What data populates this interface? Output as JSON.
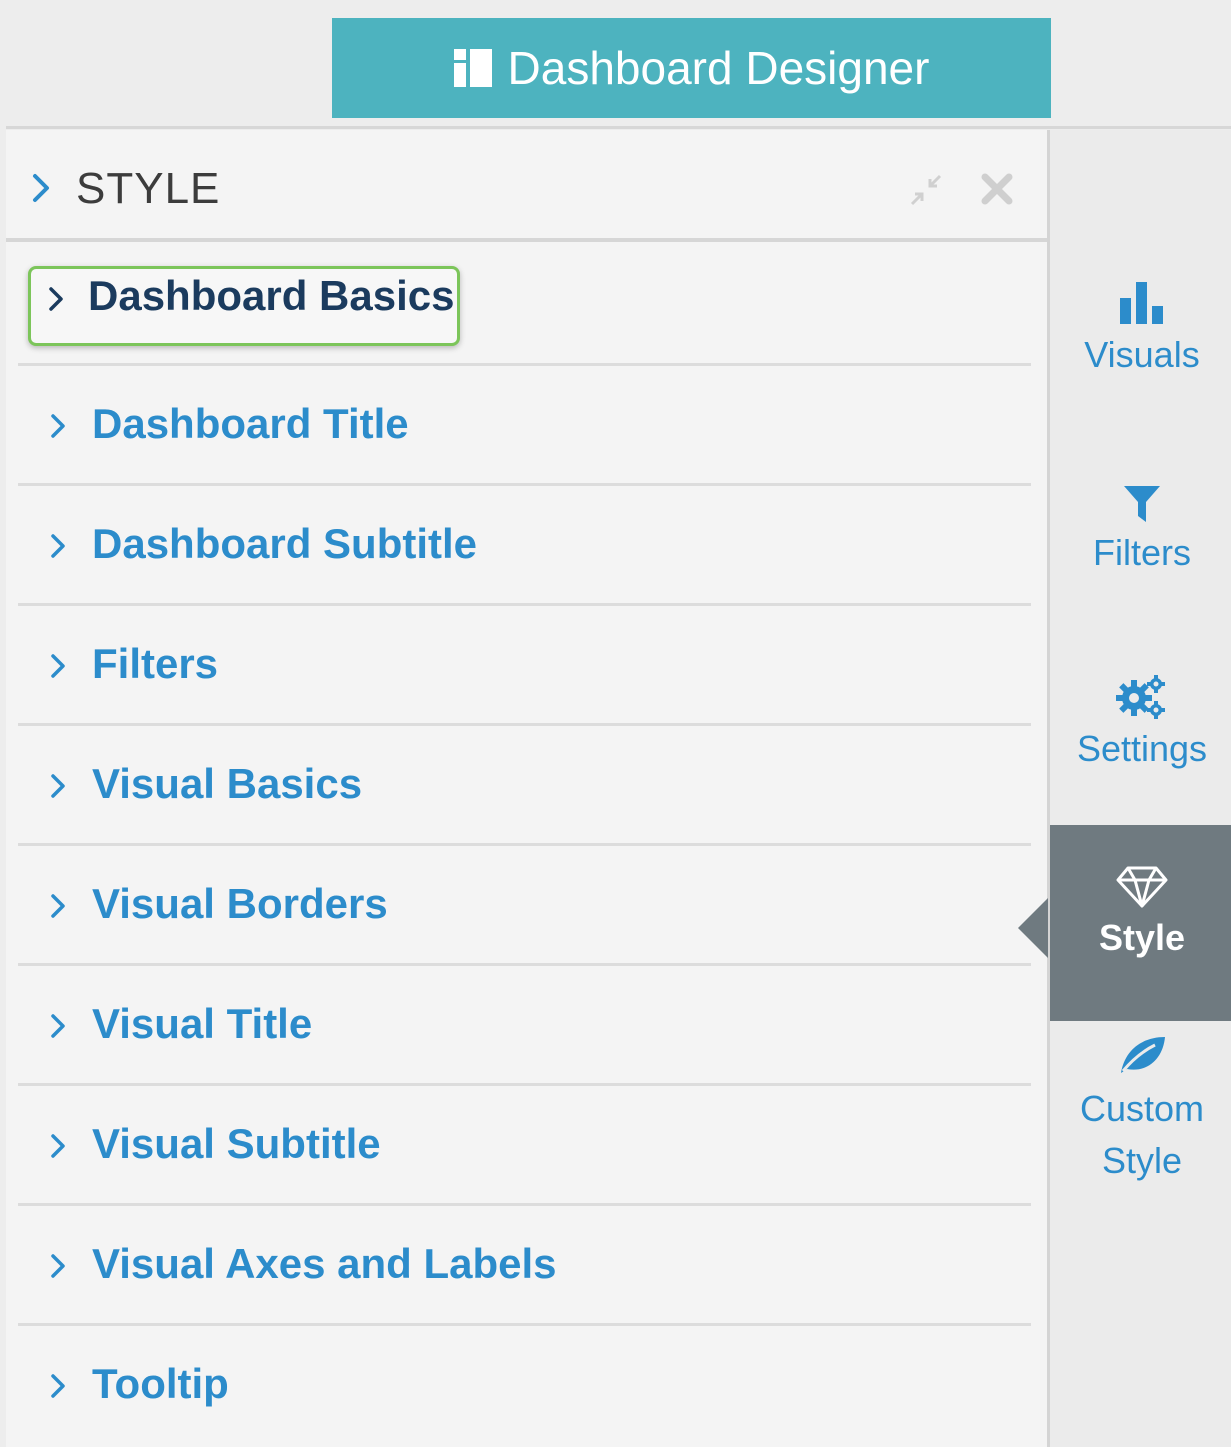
{
  "header": {
    "title": "Dashboard Designer",
    "icon": "dashboard-icon",
    "color": "#4db3bf"
  },
  "panel": {
    "title": "STYLE",
    "collapse_icon": "compress-icon",
    "close_icon": "close-icon"
  },
  "sections": [
    {
      "label": "Dashboard Basics",
      "active": true
    },
    {
      "label": "Dashboard Title"
    },
    {
      "label": "Dashboard Subtitle"
    },
    {
      "label": "Filters"
    },
    {
      "label": "Visual Basics"
    },
    {
      "label": "Visual Borders"
    },
    {
      "label": "Visual Title"
    },
    {
      "label": "Visual Subtitle"
    },
    {
      "label": "Visual Axes and Labels"
    },
    {
      "label": "Tooltip"
    }
  ],
  "sidebar": {
    "items": [
      {
        "label": "Visuals",
        "icon": "bar-chart-icon"
      },
      {
        "label": "Filters",
        "icon": "funnel-icon"
      },
      {
        "label": "Settings",
        "icon": "gears-icon"
      },
      {
        "label": "Style",
        "icon": "diamond-icon",
        "active": true
      },
      {
        "label_line1": "Custom",
        "label_line2": "Style",
        "icon": "leaf-icon"
      }
    ]
  },
  "colors": {
    "accent_blue": "#2c8ccb",
    "active_dark_label": "#1b3b5e",
    "highlight_green": "#7cc55a",
    "sidebar_active_bg": "#6f7a80"
  }
}
